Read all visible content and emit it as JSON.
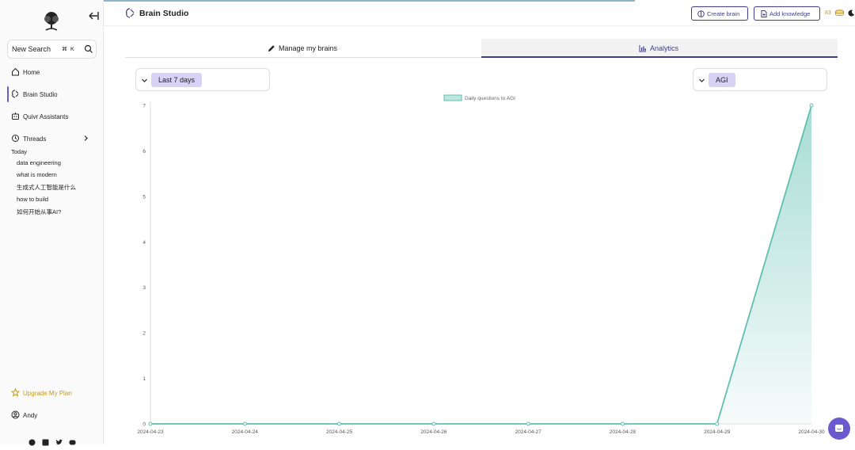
{
  "sidebar": {
    "search": {
      "label": "New Search",
      "shortcut": "⌘ K"
    },
    "items": [
      {
        "label": "Home",
        "icon": "home-icon"
      },
      {
        "label": "Brain Studio",
        "icon": "brain-icon",
        "active": true
      },
      {
        "label": "Quivr Assistants",
        "icon": "robot-icon"
      },
      {
        "label": "Threads",
        "icon": "history-icon"
      }
    ],
    "threads_group": "Today",
    "threads": [
      "data engineering",
      "what is modern",
      "生成式人工智能是什么",
      "how to build",
      "如何开始从事AI?"
    ],
    "upgrade_label": "Upgrade My Plan",
    "user_name": "Andy",
    "socials": [
      "github-icon",
      "linkedin-icon",
      "twitter-icon",
      "discord-icon"
    ]
  },
  "header": {
    "title": "Brain Studio",
    "create_brain": "Create brain",
    "add_knowledge": "Add knowledge",
    "credits": "83"
  },
  "tabs": [
    {
      "label": "Manage my brains",
      "icon": "pencil-icon"
    },
    {
      "label": "Analytics",
      "icon": "chart-icon",
      "active": true
    }
  ],
  "filters": {
    "range": "Last 7 days",
    "brain": "AGI"
  },
  "colors": {
    "accent": "#3f3d8f",
    "pill": "#d8d2f4",
    "series": "#5fbfb0",
    "gold": "#c49a1a"
  },
  "chart_data": {
    "type": "area",
    "legend_position": "top-center",
    "x": [
      "2024-04-23",
      "2024-04-24",
      "2024-04-25",
      "2024-04-26",
      "2024-04-27",
      "2024-04-28",
      "2024-04-29",
      "2024-04-30"
    ],
    "series": [
      {
        "name": "Daily questions to AGI",
        "values": [
          0,
          0,
          0,
          0,
          0,
          0,
          0,
          7
        ]
      }
    ],
    "ylim": [
      0,
      7
    ],
    "yticks": [
      0,
      1,
      2,
      3,
      4,
      5,
      6,
      7
    ],
    "grid": false
  }
}
